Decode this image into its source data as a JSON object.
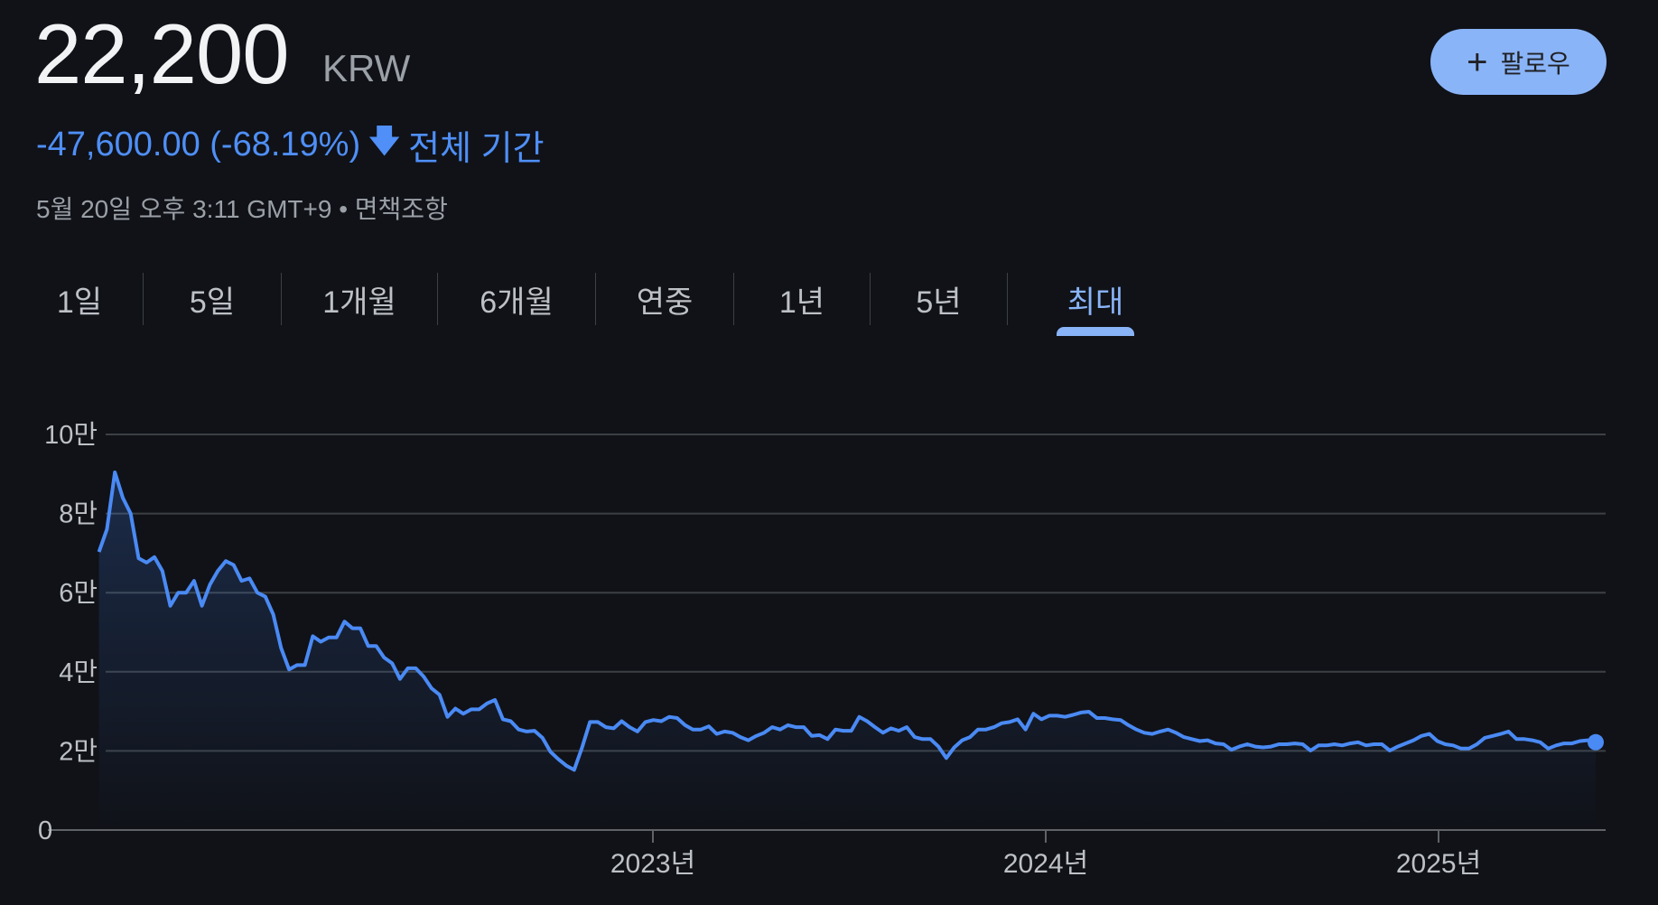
{
  "header": {
    "price": "22,200",
    "currency": "KRW",
    "change": "-47,600.00 (-68.19%)",
    "change_arrow_icon": "arrow-down-icon",
    "period": "전체 기간",
    "timestamp": "5월 20일 오후 3:11 GMT+9 • 면책조항",
    "follow_label": "팔로우",
    "follow_icon": "plus-icon"
  },
  "tabs": [
    {
      "label": "1일"
    },
    {
      "label": "5일"
    },
    {
      "label": "1개월"
    },
    {
      "label": "6개월"
    },
    {
      "label": "연중"
    },
    {
      "label": "1년"
    },
    {
      "label": "5년"
    },
    {
      "label": "최대",
      "active": true
    }
  ],
  "colors": {
    "background": "#101218",
    "line": "#4a8af4",
    "accent": "#8ab4f8",
    "grid": "#3c4043"
  },
  "chart_data": {
    "type": "area",
    "title": "",
    "xlabel": "",
    "ylabel": "",
    "ylim": [
      0,
      100000
    ],
    "yticks": [
      {
        "value": 100000,
        "label": "10만"
      },
      {
        "value": 80000,
        "label": "8만"
      },
      {
        "value": 60000,
        "label": "6만"
      },
      {
        "value": 40000,
        "label": "4만"
      },
      {
        "value": 20000,
        "label": "2만"
      },
      {
        "value": 0,
        "label": "0"
      }
    ],
    "xticks": [
      {
        "value": 2023,
        "label": "2023년"
      },
      {
        "value": 2024,
        "label": "2024년"
      },
      {
        "value": 2025,
        "label": "2025년"
      }
    ],
    "x_range_years": [
      2021.59,
      2025.4
    ],
    "grid": true,
    "last_value": 22200,
    "values": [
      70300,
      76000,
      90400,
      84000,
      80000,
      68700,
      67600,
      69000,
      65500,
      56700,
      60000,
      60000,
      63000,
      56700,
      62000,
      65500,
      68000,
      67000,
      63000,
      63600,
      60000,
      59000,
      54500,
      46000,
      40600,
      41700,
      41700,
      49000,
      47600,
      48700,
      48700,
      52700,
      51000,
      51000,
      46500,
      46500,
      43600,
      42200,
      38200,
      40900,
      40900,
      38800,
      35800,
      34200,
      28600,
      30700,
      29400,
      30500,
      30500,
      32000,
      32900,
      28000,
      27500,
      25400,
      24900,
      25100,
      23300,
      19800,
      17900,
      16300,
      15200,
      20900,
      27300,
      27300,
      26000,
      25700,
      27500,
      26000,
      24900,
      27300,
      27800,
      27500,
      28600,
      28300,
      26500,
      25400,
      25400,
      26200,
      24300,
      24900,
      24600,
      23500,
      22700,
      23800,
      24600,
      26000,
      25400,
      26500,
      26000,
      26000,
      23800,
      24000,
      23000,
      25400,
      25100,
      25100,
      28600,
      27500,
      26000,
      24600,
      25700,
      25100,
      26000,
      23500,
      23000,
      23000,
      21100,
      18200,
      20900,
      22700,
      23500,
      25400,
      25400,
      26000,
      27000,
      27300,
      28000,
      25400,
      29400,
      28000,
      28900,
      28900,
      28600,
      29100,
      29700,
      29900,
      28300,
      28300,
      28000,
      27800,
      26500,
      25400,
      24600,
      24300,
      24900,
      25400,
      24600,
      23500,
      23000,
      22500,
      22700,
      21900,
      21700,
      20300,
      21100,
      21700,
      21100,
      20900,
      21100,
      21700,
      21700,
      21900,
      21700,
      20100,
      21400,
      21400,
      21700,
      21400,
      21900,
      22200,
      21400,
      21700,
      21700,
      20100,
      21100,
      21900,
      22700,
      23800,
      24300,
      22500,
      21700,
      21400,
      20600,
      20600,
      21700,
      23300,
      23800,
      24300,
      24900,
      23000,
      23000,
      22700,
      22200,
      20600,
      21400,
      21900,
      21900,
      22500,
      22700,
      22200
    ]
  }
}
